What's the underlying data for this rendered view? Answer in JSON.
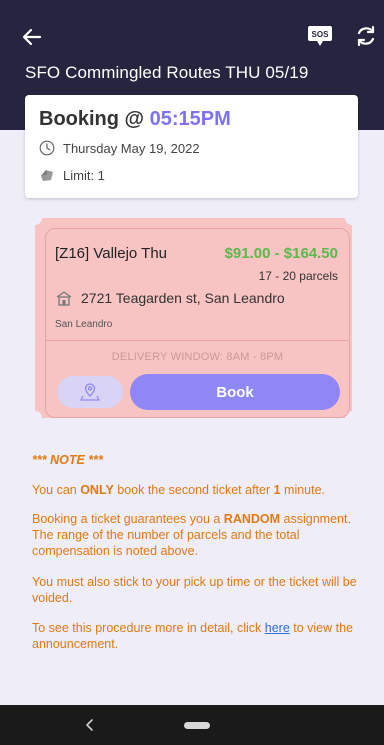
{
  "header": {
    "title": "SFO Commingled Routes THU 05/19",
    "sos_label": "SOS",
    "background": "#25253f"
  },
  "booking": {
    "prefix": "Booking @ ",
    "time": "05:15PM",
    "date": "Thursday May 19, 2022",
    "limit": "Limit: 1"
  },
  "ticket": {
    "name": "[Z16] Vallejo Thu",
    "price": "$91.00 - $164.50",
    "parcels": "17 - 20 parcels",
    "address": "2721 Teagarden st, San Leandro",
    "city": "San Leandro",
    "window": "DELIVERY WINDOW: 8AM - 8PM",
    "book_label": "Book",
    "colors": {
      "ticket_bg": "#f8c3c3",
      "price": "#5bb84a",
      "book": "#8e87f5"
    }
  },
  "note": {
    "title": "*** NOTE ***",
    "line1": {
      "a": "You can ",
      "b": "ONLY",
      "c": " book the second ticket after ",
      "d": "1",
      "e": " minute."
    },
    "line2": {
      "a": "Booking a ticket guarantees you a ",
      "b": "RANDOM",
      "c": " assignment. The range of the number of parcels and the total compensation is noted above."
    },
    "line3": "You must also stick to your pick up time or the ticket will be voided.",
    "line4": {
      "a": "To see this procedure more in detail, click ",
      "link": "here",
      "c": " to view the announcement."
    },
    "color": "#e07a12"
  },
  "icons": [
    "arrow-left-icon",
    "sos-icon",
    "refresh-icon",
    "clock-icon",
    "tag-icon",
    "home-icon",
    "map-pin-icon",
    "chevron-left-icon"
  ]
}
